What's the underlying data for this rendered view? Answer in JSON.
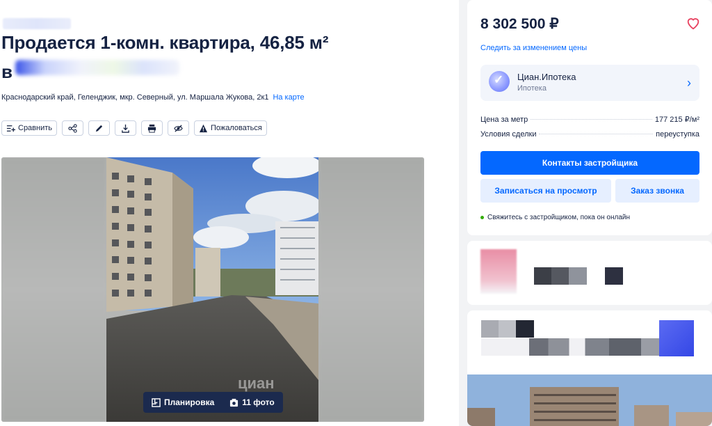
{
  "listing": {
    "title": "Продается 1-комн. квартира, 46,85 м²",
    "title_prefix_line2": "в",
    "address": "Краснодарский край, Геленджик, мкр. Северный, ул. Маршала Жукова, 2к1",
    "map_link": "На карте"
  },
  "toolbar": {
    "compare_label": "Сравнить",
    "complain_label": "Пожаловаться"
  },
  "gallery": {
    "plan_label": "Планировка",
    "photos_label": "11 фото",
    "watermark": "циан"
  },
  "offer": {
    "price": "8 302 500 ₽",
    "price_watch": "Следить за изменением цены",
    "mortgage_name": "Циан.Ипотека",
    "mortgage_sub": "Ипотека",
    "price_per_meter_label": "Цена за метр",
    "price_per_meter_value": "177 215 ₽/м²",
    "deal_terms_label": "Условия сделки",
    "deal_terms_value": "переуступка",
    "contact_button": "Контакты застройщика",
    "viewing_button": "Записаться на просмотр",
    "callback_button": "Заказ звонка",
    "online_note": "Свяжитесь с застройщиком, пока он онлайн"
  },
  "colors": {
    "accent": "#0468ff",
    "text": "#152242",
    "online": "#34ac0a"
  }
}
